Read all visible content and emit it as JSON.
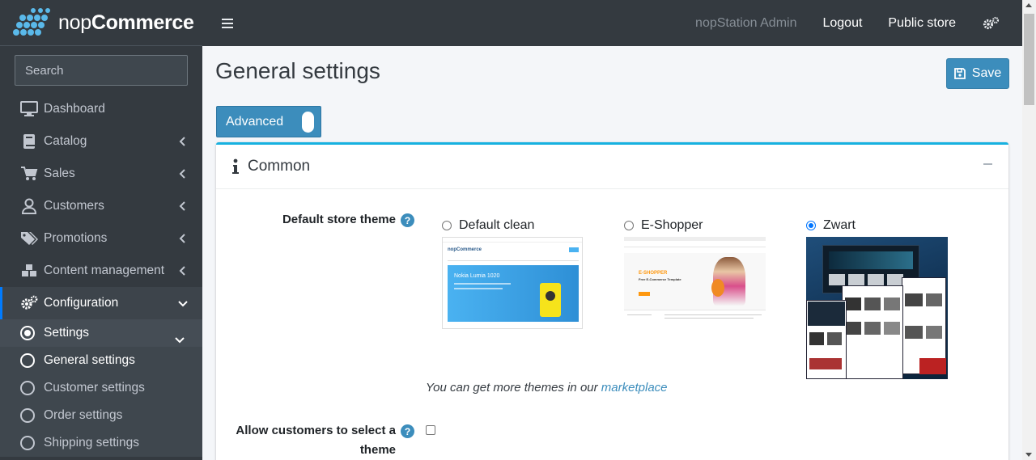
{
  "brand": {
    "name_light": "nop",
    "name_bold": "Commerce"
  },
  "sidebar": {
    "search_placeholder": "Search",
    "items": [
      {
        "label": "Dashboard",
        "icon": "monitor-icon",
        "has_children": false
      },
      {
        "label": "Catalog",
        "icon": "book-icon",
        "has_children": true
      },
      {
        "label": "Sales",
        "icon": "cart-icon",
        "has_children": true
      },
      {
        "label": "Customers",
        "icon": "user-icon",
        "has_children": true
      },
      {
        "label": "Promotions",
        "icon": "tags-icon",
        "has_children": true
      },
      {
        "label": "Content management",
        "icon": "cubes-icon",
        "has_children": true
      },
      {
        "label": "Configuration",
        "icon": "gears-icon",
        "has_children": true,
        "expanded": true
      }
    ],
    "sub_items": [
      {
        "label": "Settings"
      },
      {
        "label": "General settings"
      },
      {
        "label": "Customer settings"
      },
      {
        "label": "Order settings"
      },
      {
        "label": "Shipping settings"
      }
    ]
  },
  "topbar": {
    "user": "nopStation Admin",
    "logout": "Logout",
    "public_store": "Public store"
  },
  "page": {
    "title": "General settings",
    "save_label": "Save",
    "advanced_label": "Advanced"
  },
  "card": {
    "title": "Common",
    "default_theme_label": "Default store theme",
    "themes": [
      {
        "label": "Default clean",
        "selected": false
      },
      {
        "label": "E-Shopper",
        "selected": false
      },
      {
        "label": "Zwart",
        "selected": true
      }
    ],
    "thumbs": {
      "default_clean": {
        "brand": "nopCommerce",
        "headline": "Nokia Lumia 1020"
      },
      "eshopper": {
        "brand": "E-SHOPPER",
        "headline": "Free E-Commerce Template"
      }
    },
    "marketplace_prefix": "You can get more themes in our ",
    "marketplace_link": "marketplace",
    "allow_select_label_line1": "Allow customers to select a",
    "allow_select_label_line2": "theme"
  },
  "colors": {
    "sidebar_bg": "#343a40",
    "accent": "#3c8dbc",
    "card_border": "#17b1e0",
    "active_nav": "#007bff"
  }
}
